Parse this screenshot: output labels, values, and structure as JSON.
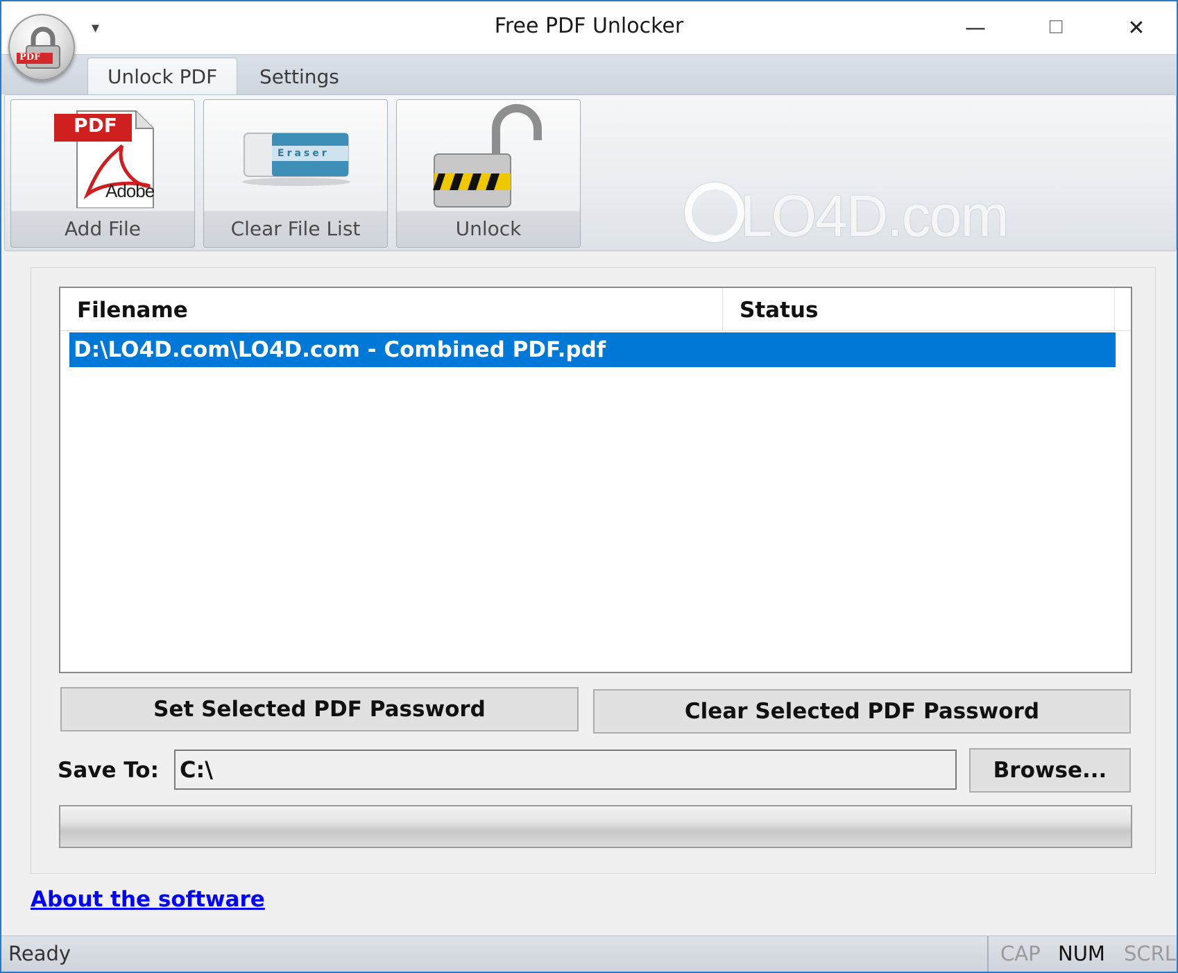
{
  "window": {
    "title": "Free PDF Unlocker",
    "qat_arrow": "▾",
    "minimize": "—",
    "maximize": "☐",
    "close": "✕",
    "app_icon_text": "PDF"
  },
  "ribbon": {
    "tabs": [
      {
        "label": "Unlock PDF",
        "active": true
      },
      {
        "label": "Settings",
        "active": false
      }
    ],
    "buttons": [
      {
        "label": "Add File",
        "icon": "pdf-adobe-icon",
        "icon_text": "PDF",
        "icon_sub": "Adobe"
      },
      {
        "label": "Clear File List",
        "icon": "eraser-icon",
        "icon_text": "Eraser"
      },
      {
        "label": "Unlock",
        "icon": "open-padlock-icon"
      }
    ],
    "watermark": "LO4D.com"
  },
  "file_list": {
    "columns": [
      "Filename",
      "Status"
    ],
    "rows": [
      {
        "filename": "D:\\LO4D.com\\LO4D.com - Combined PDF.pdf",
        "status": "",
        "selected": true
      }
    ]
  },
  "actions": {
    "set_password": "Set Selected PDF Password",
    "clear_password": "Clear Selected PDF Password"
  },
  "save": {
    "label": "Save To:",
    "path": "C:\\",
    "browse": "Browse..."
  },
  "progress": {
    "value": 0
  },
  "about_link": "About the software",
  "status_bar": {
    "text": "Ready",
    "indicators": [
      {
        "label": "CAP",
        "active": false
      },
      {
        "label": "NUM",
        "active": true
      },
      {
        "label": "SCRL",
        "active": false
      }
    ]
  },
  "colors": {
    "selection": "#0078d7",
    "window_border": "#2b79c5",
    "link": "#0000ff"
  }
}
